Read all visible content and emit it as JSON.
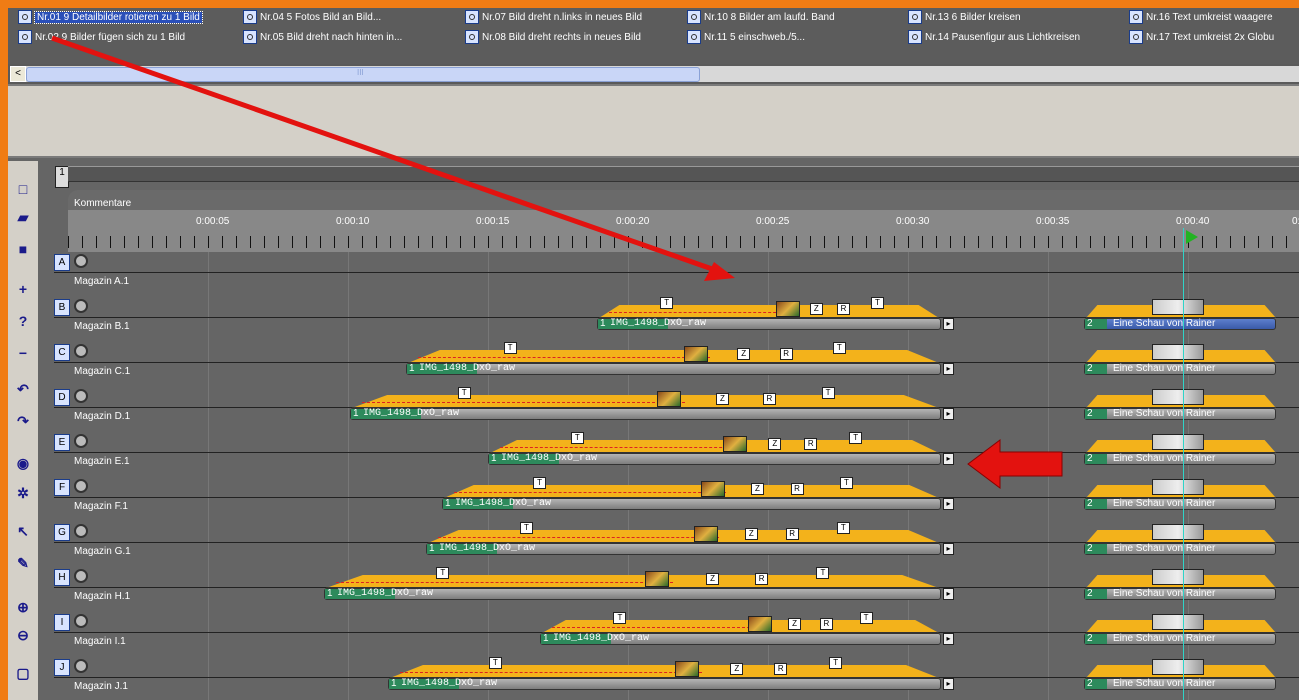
{
  "effects": [
    {
      "label": "Nr.01  9 Detailbilder rotieren zu 1 Bild",
      "selected": true
    },
    {
      "label": "Nr.02  9 Bilder fügen sich zu 1 Bild"
    },
    {
      "label": "Nr.04  5 Fotos Bild an Bild..."
    },
    {
      "label": "Nr.05  Bild dreht nach hinten in..."
    },
    {
      "label": "Nr.07 Bild dreht n.links in neues Bild"
    },
    {
      "label": "Nr.08 Bild dreht rechts in neues Bild"
    },
    {
      "label": "Nr.10  8 Bilder am laufd. Band"
    },
    {
      "label": "Nr.11  5 einschweb./5..."
    },
    {
      "label": "Nr.13  6 Bilder kreisen"
    },
    {
      "label": "Nr.14 Pausenfigur aus Lichtkreisen"
    },
    {
      "label": "Nr.16 Text umkreist waagere"
    },
    {
      "label": "Nr.17 Text umkreist 2x Globu"
    }
  ],
  "scroll_arrow": "<",
  "scroll_grip": "III",
  "track_number": "1",
  "comments_label": "Kommentare",
  "ruler": [
    "0:00:05",
    "0:00:10",
    "0:00:15",
    "0:00:20",
    "0:00:25",
    "0:00:30",
    "0:00:35",
    "0:00:40",
    "0:"
  ],
  "tools": [
    "new-icon",
    "open-icon",
    "save-icon",
    "obj-plus-icon",
    "obj-query-icon",
    "obj-minus-icon",
    "undo-icon",
    "redo-icon",
    "color-wheel-icon",
    "effects-icon",
    "cursor-icon",
    "pen-icon",
    "zoom-in-icon",
    "zoom-out-icon",
    "square-icon"
  ],
  "lanes": [
    {
      "letter": "A",
      "name": "Magazin A.1",
      "clip": null,
      "show": null
    },
    {
      "letter": "B",
      "name": "Magazin B.1",
      "clip": "IMG_1498_DxO_raw",
      "clip_num": "1",
      "show": "Eine Schau von Rainer",
      "show_num": "2"
    },
    {
      "letter": "C",
      "name": "Magazin C.1",
      "clip": "IMG_1498_DxO_raw",
      "clip_num": "1",
      "show": "Eine Schau von Rainer",
      "show_num": "2"
    },
    {
      "letter": "D",
      "name": "Magazin D.1",
      "clip": "IMG_1498_DxO_raw",
      "clip_num": "1",
      "show": "Eine Schau von Rainer",
      "show_num": "2"
    },
    {
      "letter": "E",
      "name": "Magazin E.1",
      "clip": "IMG_1498_DxO_raw",
      "clip_num": "1",
      "show": "Eine Schau von Rainer",
      "show_num": "2"
    },
    {
      "letter": "F",
      "name": "Magazin F.1",
      "clip": "IMG_1498_DxO_raw",
      "clip_num": "1",
      "show": "Eine Schau von Rainer",
      "show_num": "2"
    },
    {
      "letter": "G",
      "name": "Magazin G.1",
      "clip": "IMG_1498_DxO_raw",
      "clip_num": "1",
      "show": "Eine Schau von Rainer",
      "show_num": "2"
    },
    {
      "letter": "H",
      "name": "Magazin H.1",
      "clip": "IMG_1498_DxO_raw",
      "clip_num": "1",
      "show": "Eine Schau von Rainer",
      "show_num": "2"
    },
    {
      "letter": "I",
      "name": "Magazin I.1",
      "clip": "IMG_1498_DxO_raw",
      "clip_num": "1",
      "show": "Eine Schau von Rainer",
      "show_num": "2"
    },
    {
      "letter": "J",
      "name": "Magazin J.1",
      "clip": "IMG_1498_DxO_raw",
      "clip_num": "1",
      "show": "Eine Schau von Rainer",
      "show_num": "2"
    }
  ],
  "markers": {
    "z": "Z",
    "r": "R",
    "t": "T"
  },
  "colors": {
    "frame": "#f07c14",
    "clip_fill": "#f3b21b",
    "clip_start": "#2d8a5c",
    "arrow": "#e3120f",
    "playhead": "#2fd4c8"
  }
}
